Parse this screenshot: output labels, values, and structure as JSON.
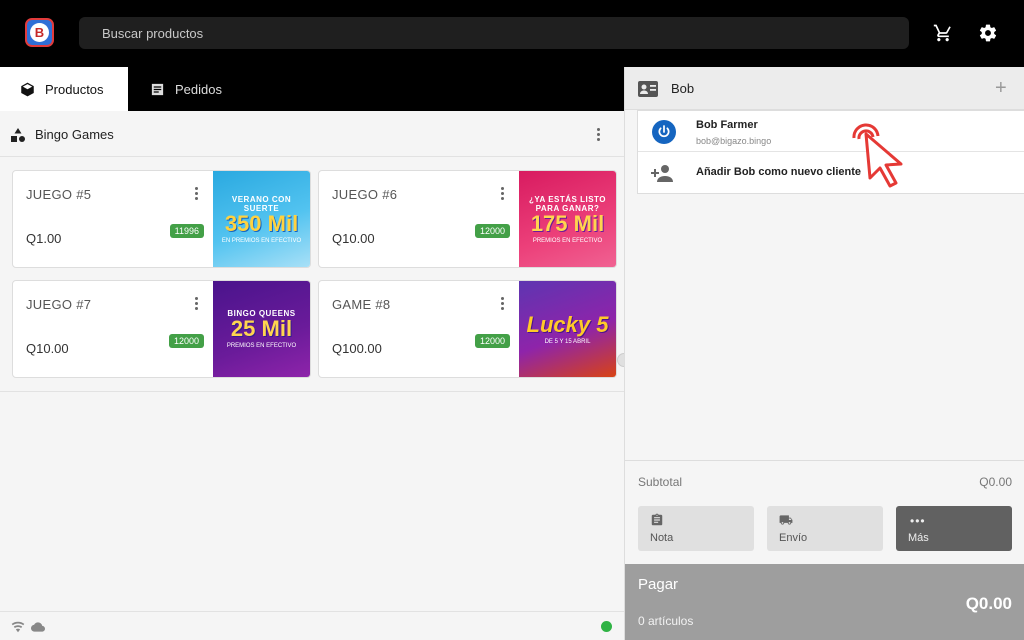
{
  "search": {
    "placeholder": "Buscar productos"
  },
  "tabs": [
    {
      "label": "Productos",
      "active": true,
      "icon": "cube-icon"
    },
    {
      "label": "Pedidos",
      "active": false,
      "icon": "list-icon"
    }
  ],
  "category": {
    "title": "Bingo Games",
    "icon": "shapes-icon"
  },
  "products": [
    {
      "title": "JUEGO #5",
      "price": "Q1.00",
      "stock": "11996",
      "img_top": "VERANO CON SUERTE",
      "img_big": "350 Mil",
      "img_sub": "EN PREMIOS EN EFECTIVO"
    },
    {
      "title": "JUEGO #6",
      "price": "Q10.00",
      "stock": "12000",
      "img_top": "¿YA ESTÁS LISTO PARA GANAR?",
      "img_big": "175 Mil",
      "img_sub": "PREMIOS EN EFECTIVO"
    },
    {
      "title": "JUEGO #7",
      "price": "Q10.00",
      "stock": "12000",
      "img_top": "BINGO QUEENS",
      "img_big": "25 Mil",
      "img_sub": "PREMIOS EN EFECTIVO"
    },
    {
      "title": "GAME #8",
      "price": "Q100.00",
      "stock": "12000",
      "img_top": "",
      "img_big": "Lucky 5",
      "img_sub": "DE 5 Y 15 ABRIL"
    }
  ],
  "customer": {
    "input_value": "Bob",
    "suggestion_name": "Bob Farmer",
    "suggestion_email": "bob@bigazo.bingo",
    "add_label": "Añadir Bob como nuevo cliente"
  },
  "summary": {
    "subtotal_label": "Subtotal",
    "subtotal_value": "Q0.00",
    "actions": [
      "Nota",
      "Envío",
      "Más"
    ],
    "pay_label": "Pagar",
    "pay_count": "0 artículos",
    "pay_total": "Q0.00"
  },
  "colors": {
    "accent_green": "#43a047",
    "status_online": "#2fb344",
    "brand_blue": "#1565c0"
  }
}
